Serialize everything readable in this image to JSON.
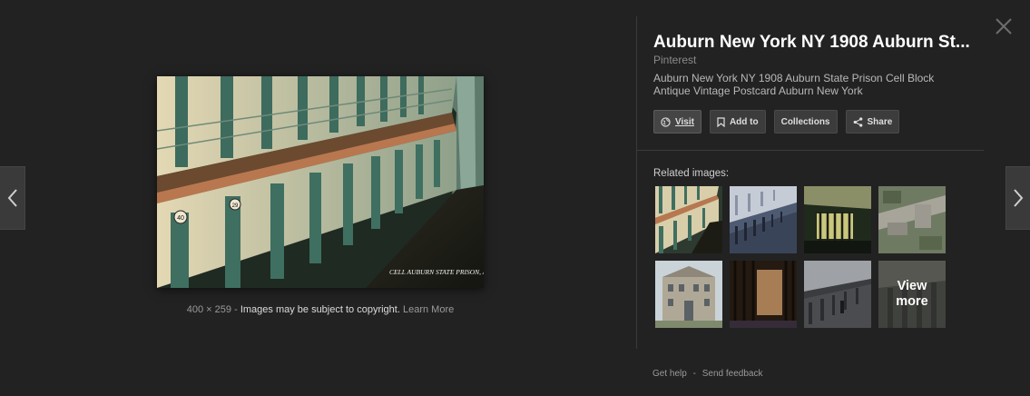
{
  "image": {
    "dimensions": "400 × 259",
    "sep": "-",
    "copyright_text": "Images may be subject to copyright.",
    "learn_more": "Learn More",
    "postcard_text": "CELL AUBURN STATE PRISON, AUBURN, N.Y.",
    "cell_numbers": [
      "40",
      "29"
    ]
  },
  "details": {
    "title": "Auburn New York NY 1908 Auburn St...",
    "source": "Pinterest",
    "description": "Auburn New York NY 1908 Auburn State Prison Cell Block Antique Vintage Postcard Auburn New York"
  },
  "actions": {
    "visit": "Visit",
    "add_to": "Add to",
    "collections": "Collections",
    "share": "Share"
  },
  "related": {
    "label": "Related images:",
    "view_more": "View more"
  },
  "footer": {
    "get_help": "Get help",
    "sep": "-",
    "send_feedback": "Send feedback"
  },
  "icons": {
    "prev": "chevron-left-icon",
    "next": "chevron-right-icon",
    "close": "close-icon",
    "visit": "globe-icon",
    "add_to": "bookmark-icon",
    "share": "share-icon"
  },
  "colors": {
    "background": "#222222",
    "button_bg": "#3c3c3c",
    "divider": "#3b3b3b"
  }
}
